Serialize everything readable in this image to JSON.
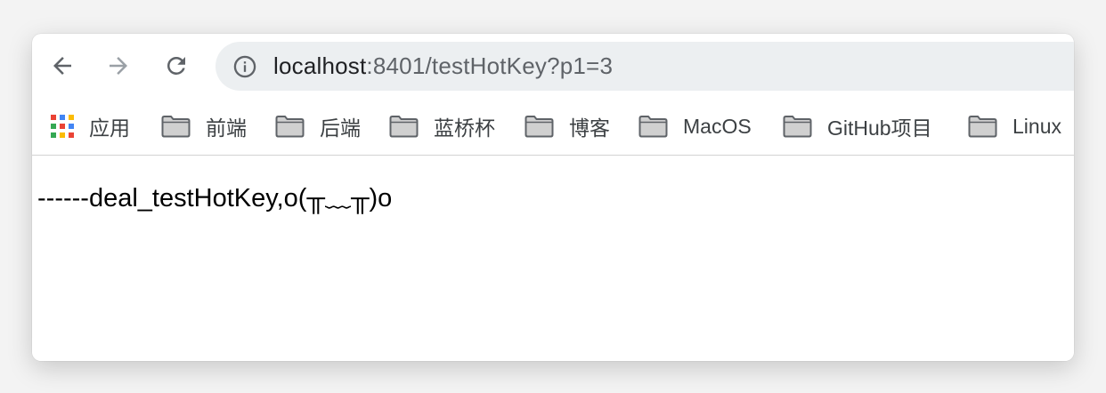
{
  "toolbar": {
    "back_icon": "arrow-left-icon",
    "forward_icon": "arrow-right-icon",
    "reload_icon": "reload-icon",
    "site_info_icon": "info-icon"
  },
  "address_bar": {
    "url_host": "localhost",
    "url_rest": ":8401/testHotKey?p1=3",
    "background_color": "#eceff1"
  },
  "bookmarks": [
    {
      "label": "应用",
      "icon": "apps-grid-icon"
    },
    {
      "label": "前端",
      "icon": "folder-icon"
    },
    {
      "label": "后端",
      "icon": "folder-icon"
    },
    {
      "label": "蓝桥杯",
      "icon": "folder-icon"
    },
    {
      "label": "博客",
      "icon": "folder-icon"
    },
    {
      "label": "MacOS",
      "icon": "folder-icon"
    },
    {
      "label": "GitHub项目",
      "icon": "folder-icon"
    },
    {
      "label": "Linux",
      "icon": "folder-icon"
    }
  ],
  "page": {
    "body_text": "------deal_testHotKey,o(╥﹏╥)o"
  },
  "colors": {
    "apps_grid": [
      "#ea4335",
      "#4285f4",
      "#fbbc05",
      "#34a853",
      "#ea4335",
      "#4285f4",
      "#34a853",
      "#fbbc05",
      "#ea4335"
    ],
    "icon_gray": "#5f6368",
    "icon_disabled": "#9aa0a6"
  }
}
